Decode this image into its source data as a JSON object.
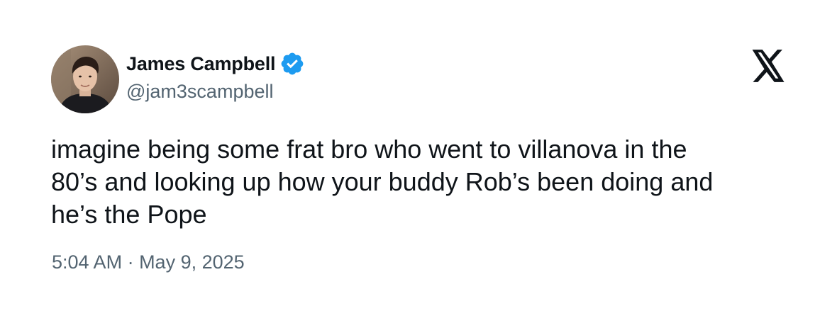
{
  "tweet": {
    "author": {
      "display_name": "James Campbell",
      "handle": "@jam3scampbell",
      "verified": true,
      "verified_icon": "verified-badge-icon",
      "avatar_icon": "user-avatar"
    },
    "text": "imagine being some frat bro who went to villanova in the\n80’s and looking up how your buddy Rob’s been doing and\nhe’s the Pope",
    "time": "5:04 AM",
    "separator": " · ",
    "date": "May 9, 2025"
  },
  "brand": {
    "logo_icon": "x-logo-icon"
  },
  "colors": {
    "text_primary": "#0f1419",
    "text_secondary": "#536471",
    "verified_blue": "#1d9bf0",
    "background": "#ffffff"
  }
}
